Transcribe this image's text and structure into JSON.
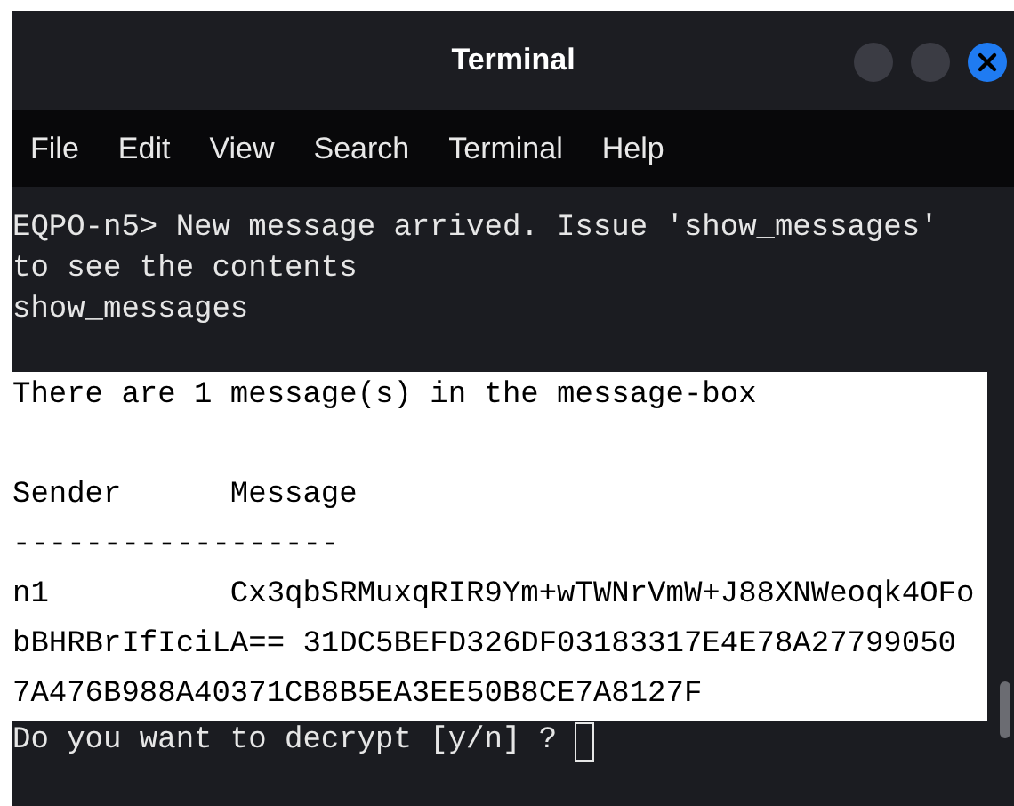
{
  "window": {
    "title": "Terminal",
    "buttons": [
      {
        "kind": "minimize"
      },
      {
        "kind": "maximize"
      },
      {
        "kind": "close"
      }
    ]
  },
  "menu": [
    "File",
    "Edit",
    "View",
    "Search",
    "Terminal",
    "Help"
  ],
  "lines": [
    {
      "kind": "text",
      "text": "EQPO-n5> New message arrived. Issue 'show_messages'",
      "highlighted": false
    },
    {
      "kind": "text",
      "text": "to see the contents",
      "highlighted": false
    },
    {
      "kind": "text",
      "text": "show_messages",
      "highlighted": false
    },
    {
      "kind": "blank",
      "highlighted": false
    },
    {
      "kind": "text",
      "text": "There are 1 message(s) in the message-box",
      "highlighted": true
    },
    {
      "kind": "blank",
      "highlighted": true
    },
    {
      "kind": "text",
      "text": "Sender      Message",
      "highlighted": true
    },
    {
      "kind": "text",
      "text": "------------------",
      "highlighted": true
    },
    {
      "kind": "text",
      "text": "n1          Cx3qbSRMuxqRIR9Ym+wTWNrVmW+J88XNWeoqk4OFo",
      "highlighted": true
    },
    {
      "kind": "text",
      "text": "bBHRBrIfIciLA== 31DC5BEFD326DF03183317E4E78A27799050",
      "highlighted": true
    },
    {
      "kind": "text",
      "text": "7A476B988A40371CB8B5EA3EE50B8CE7A8127F",
      "highlighted": true
    },
    {
      "kind": "prompt",
      "text": "Do you want to decrypt [y/n] ?",
      "highlighted": false
    }
  ]
}
